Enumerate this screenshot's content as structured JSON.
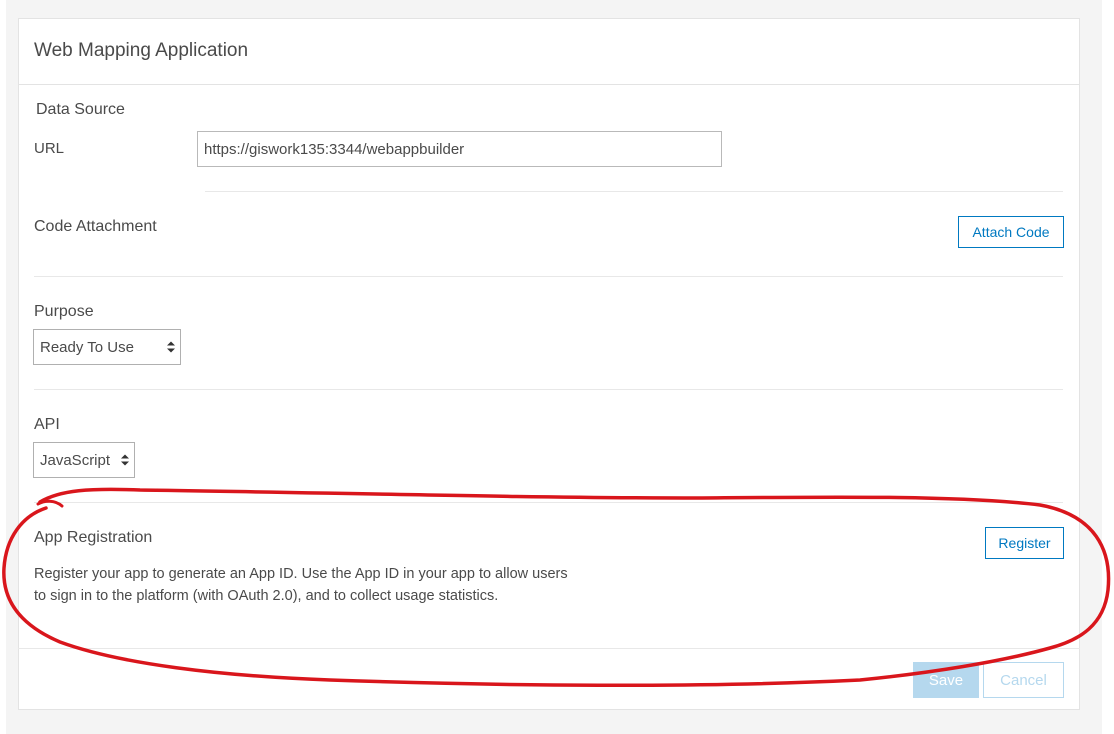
{
  "panel": {
    "title": "Web Mapping Application"
  },
  "data_source": {
    "heading": "Data Source",
    "url_label": "URL",
    "url_value": "https://giswork135:3344/webappbuilder"
  },
  "code_attachment": {
    "label": "Code Attachment",
    "button": "Attach Code"
  },
  "purpose": {
    "label": "Purpose",
    "selected": "Ready To Use"
  },
  "api": {
    "label": "API",
    "selected": "JavaScript"
  },
  "app_registration": {
    "label": "App Registration",
    "button": "Register",
    "description_line1": "Register your app to generate an App ID. Use the App ID in your app to allow users",
    "description_line2": "to sign in to the platform (with OAuth 2.0), and to collect usage statistics."
  },
  "footer": {
    "save": "Save",
    "cancel": "Cancel"
  },
  "colors": {
    "accent": "#0079c1",
    "disabled_accent": "#b5d8ee",
    "annotation": "#d9161c"
  }
}
